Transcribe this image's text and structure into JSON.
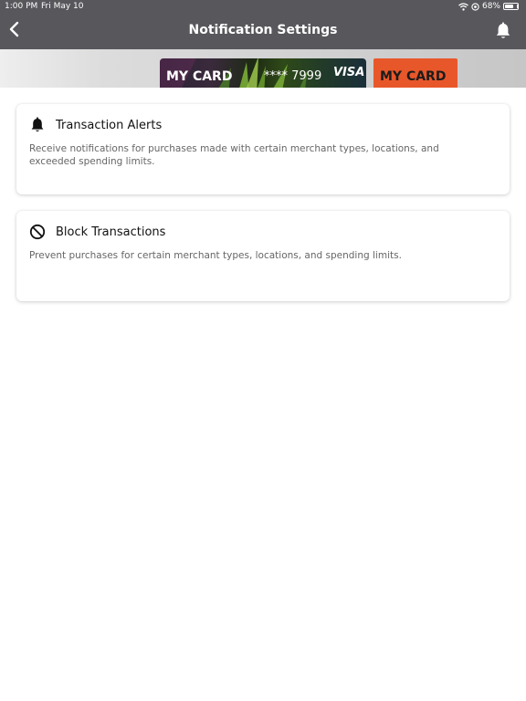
{
  "status_bar": {
    "time": "1:00 PM",
    "date": "Fri May 10",
    "battery_text": "68%",
    "battery_level": 0.68,
    "icons": [
      "wifi-icon",
      "location-icon",
      "battery-icon"
    ]
  },
  "nav": {
    "title": "Notification Settings",
    "back_icon": "chevron-left-icon",
    "bell_icon": "bell-icon"
  },
  "cards_carousel": {
    "primary": {
      "name": "MY CARD",
      "number": "**** 7999",
      "brand": "VISA"
    },
    "secondary": {
      "name": "MY CARD",
      "color": "#e8572a"
    }
  },
  "settings": {
    "transaction_alerts": {
      "icon": "bell-icon",
      "title": "Transaction Alerts",
      "description": "Receive notifications for purchases made with certain merchant types, locations, and exceeded spending limits."
    },
    "block_transactions": {
      "icon": "block-icon",
      "title": "Block Transactions",
      "description": "Prevent purchases for certain merchant types, locations, and spending limits."
    }
  },
  "colors": {
    "header": "#57575c",
    "accent_orange": "#e8572a",
    "text_primary": "#111111",
    "text_secondary": "#666666"
  }
}
